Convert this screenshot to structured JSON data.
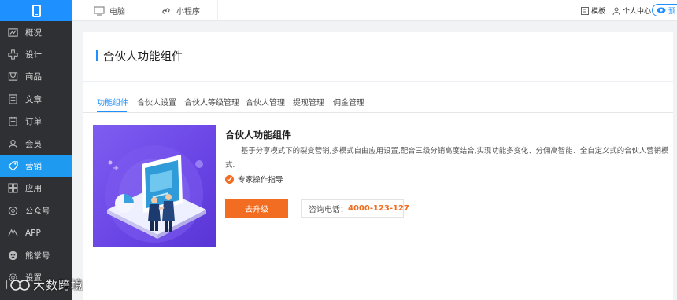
{
  "sidebar": {
    "items": [
      {
        "label": "概况",
        "icon": "chart-icon"
      },
      {
        "label": "设计",
        "icon": "design-icon"
      },
      {
        "label": "商品",
        "icon": "goods-icon"
      },
      {
        "label": "文章",
        "icon": "article-icon"
      },
      {
        "label": "订单",
        "icon": "order-icon"
      },
      {
        "label": "会员",
        "icon": "member-icon"
      },
      {
        "label": "营销",
        "icon": "tag-icon",
        "active": true
      },
      {
        "label": "应用",
        "icon": "apps-icon"
      },
      {
        "label": "公众号",
        "icon": "official-account-icon"
      },
      {
        "label": "APP",
        "icon": "app-icon"
      },
      {
        "label": "熊掌号",
        "icon": "paw-icon"
      },
      {
        "label": "设置",
        "icon": "settings-icon"
      }
    ]
  },
  "topbar": {
    "tabs": [
      {
        "label": "电脑",
        "icon": "monitor-icon"
      },
      {
        "label": "小程序",
        "icon": "mini-program-icon"
      }
    ],
    "right": {
      "template_label": "模板",
      "user_center_label": "个人中心",
      "preview_label": "预"
    }
  },
  "page": {
    "title": "合伙人功能组件",
    "tabs": [
      "功能组件",
      "合伙人设置",
      "合伙人等级管理",
      "合伙人管理",
      "提现管理",
      "佣金管理"
    ],
    "active_tab": 0
  },
  "feature": {
    "title": "合伙人功能组件",
    "description": "基于分享模式下的裂变营销,多模式自由应用设置,配合三级分销高度结合,实现功能多变化、分佣高智能、全自定义式的合伙人营销模式.",
    "expert_label": "专家操作指导",
    "upgrade_button": "去升级",
    "phone_label": "咨询电话：",
    "phone_number": "4000-123-127"
  },
  "watermark": {
    "text": "大数跨境"
  },
  "colors": {
    "sidebar_bg": "#2f3033",
    "accent": "#1e90ff",
    "orange": "#f26d21",
    "illustration": "#6b46e6"
  }
}
